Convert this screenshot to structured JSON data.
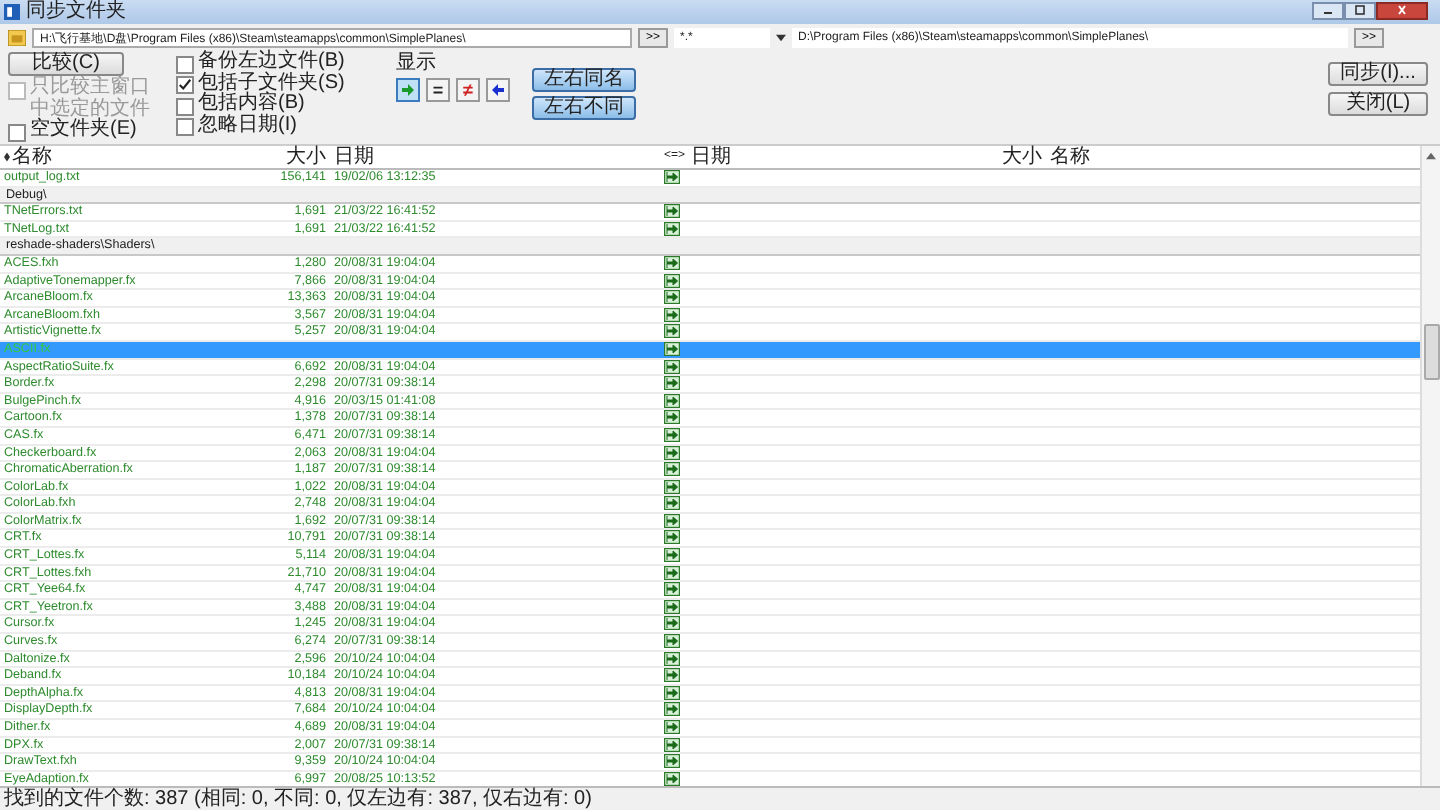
{
  "window": {
    "title": "同步文件夹"
  },
  "left_path": {
    "value": "H:\\飞行基地\\D盘\\Program Files (x86)\\Steam\\steamapps\\common\\SimplePlanes\\"
  },
  "left_browse": ">>",
  "filter": {
    "value": "*.*"
  },
  "right_path": {
    "value": "D:\\Program Files (x86)\\Steam\\steamapps\\common\\SimplePlanes\\"
  },
  "right_browse": ">>",
  "compare_button": "比较(C)",
  "left_options": [
    {
      "label": "只比较主窗口中选定的文件",
      "checked": false,
      "disabled": true
    },
    {
      "label": "空文件夹(E)",
      "checked": false,
      "disabled": false
    }
  ],
  "middle_options": [
    {
      "label": "备份左边文件(B)",
      "checked": false,
      "disabled": false
    },
    {
      "label": "包括子文件夹(S)",
      "checked": true,
      "disabled": false
    },
    {
      "label": "包括内容(B)",
      "checked": false,
      "disabled": false
    },
    {
      "label": "忽略日期(I)",
      "checked": false,
      "disabled": false
    }
  ],
  "show": {
    "label": "显示",
    "toggles": [
      {
        "kind": "right",
        "selected": true
      },
      {
        "kind": "equal",
        "symbol": "=",
        "selected": false
      },
      {
        "kind": "differ",
        "symbol": "≠",
        "selected": false
      },
      {
        "kind": "left",
        "selected": false
      }
    ]
  },
  "select_buttons": [
    "左右同名",
    "左右不同"
  ],
  "action_buttons": [
    "同步(I)...",
    "关闭(L)"
  ],
  "left_columns": [
    "名称",
    "大小",
    "日期"
  ],
  "direction_column": "<=>",
  "right_columns": [
    "日期",
    "大小",
    "名称"
  ],
  "rows": [
    {
      "kind": "file",
      "name": "output_log.txt",
      "size": "156,141",
      "date": "19/02/06 13:12:35",
      "selected": false
    },
    {
      "kind": "folder",
      "name": "Debug\\",
      "selected": false
    },
    {
      "kind": "file",
      "name": "TNetErrors.txt",
      "size": "1,691",
      "date": "21/03/22 16:41:52",
      "selected": false
    },
    {
      "kind": "file",
      "name": "TNetLog.txt",
      "size": "1,691",
      "date": "21/03/22 16:41:52",
      "selected": false
    },
    {
      "kind": "folder",
      "name": "reshade-shaders\\Shaders\\",
      "selected": false
    },
    {
      "kind": "file",
      "name": "ACES.fxh",
      "size": "1,280",
      "date": "20/08/31 19:04:04",
      "selected": false
    },
    {
      "kind": "file",
      "name": "AdaptiveTonemapper.fx",
      "size": "7,866",
      "date": "20/08/31 19:04:04",
      "selected": false
    },
    {
      "kind": "file",
      "name": "ArcaneBloom.fx",
      "size": "13,363",
      "date": "20/08/31 19:04:04",
      "selected": false
    },
    {
      "kind": "file",
      "name": "ArcaneBloom.fxh",
      "size": "3,567",
      "date": "20/08/31 19:04:04",
      "selected": false
    },
    {
      "kind": "file",
      "name": "ArtisticVignette.fx",
      "size": "5,257",
      "date": "20/08/31 19:04:04",
      "selected": false
    },
    {
      "kind": "file",
      "name": "ASCII.fx",
      "selected": true
    },
    {
      "kind": "file",
      "name": "AspectRatioSuite.fx",
      "size": "6,692",
      "date": "20/08/31 19:04:04",
      "selected": false
    },
    {
      "kind": "file",
      "name": "Border.fx",
      "size": "2,298",
      "date": "20/07/31 09:38:14",
      "selected": false
    },
    {
      "kind": "file",
      "name": "BulgePinch.fx",
      "size": "4,916",
      "date": "20/03/15 01:41:08",
      "selected": false
    },
    {
      "kind": "file",
      "name": "Cartoon.fx",
      "size": "1,378",
      "date": "20/07/31 09:38:14",
      "selected": false
    },
    {
      "kind": "file",
      "name": "CAS.fx",
      "size": "6,471",
      "date": "20/07/31 09:38:14",
      "selected": false
    },
    {
      "kind": "file",
      "name": "Checkerboard.fx",
      "size": "2,063",
      "date": "20/08/31 19:04:04",
      "selected": false
    },
    {
      "kind": "file",
      "name": "ChromaticAberration.fx",
      "size": "1,187",
      "date": "20/07/31 09:38:14",
      "selected": false
    },
    {
      "kind": "file",
      "name": "ColorLab.fx",
      "size": "1,022",
      "date": "20/08/31 19:04:04",
      "selected": false
    },
    {
      "kind": "file",
      "name": "ColorLab.fxh",
      "size": "2,748",
      "date": "20/08/31 19:04:04",
      "selected": false
    },
    {
      "kind": "file",
      "name": "ColorMatrix.fx",
      "size": "1,692",
      "date": "20/07/31 09:38:14",
      "selected": false
    },
    {
      "kind": "file",
      "name": "CRT.fx",
      "size": "10,791",
      "date": "20/07/31 09:38:14",
      "selected": false
    },
    {
      "kind": "file",
      "name": "CRT_Lottes.fx",
      "size": "5,114",
      "date": "20/08/31 19:04:04",
      "selected": false
    },
    {
      "kind": "file",
      "name": "CRT_Lottes.fxh",
      "size": "21,710",
      "date": "20/08/31 19:04:04",
      "selected": false
    },
    {
      "kind": "file",
      "name": "CRT_Yee64.fx",
      "size": "4,747",
      "date": "20/08/31 19:04:04",
      "selected": false
    },
    {
      "kind": "file",
      "name": "CRT_Yeetron.fx",
      "size": "3,488",
      "date": "20/08/31 19:04:04",
      "selected": false
    },
    {
      "kind": "file",
      "name": "Cursor.fx",
      "size": "1,245",
      "date": "20/08/31 19:04:04",
      "selected": false
    },
    {
      "kind": "file",
      "name": "Curves.fx",
      "size": "6,274",
      "date": "20/07/31 09:38:14",
      "selected": false
    },
    {
      "kind": "file",
      "name": "Daltonize.fx",
      "size": "2,596",
      "date": "20/10/24 10:04:04",
      "selected": false
    },
    {
      "kind": "file",
      "name": "Deband.fx",
      "size": "10,184",
      "date": "20/10/24 10:04:04",
      "selected": false
    },
    {
      "kind": "file",
      "name": "DepthAlpha.fx",
      "size": "4,813",
      "date": "20/08/31 19:04:04",
      "selected": false
    },
    {
      "kind": "file",
      "name": "DisplayDepth.fx",
      "size": "7,684",
      "date": "20/10/24 10:04:04",
      "selected": false
    },
    {
      "kind": "file",
      "name": "Dither.fx",
      "size": "4,689",
      "date": "20/08/31 19:04:04",
      "selected": false
    },
    {
      "kind": "file",
      "name": "DPX.fx",
      "size": "2,007",
      "date": "20/07/31 09:38:14",
      "selected": false
    },
    {
      "kind": "file",
      "name": "DrawText.fxh",
      "size": "9,359",
      "date": "20/10/24 10:04:04",
      "selected": false
    },
    {
      "kind": "file",
      "name": "EyeAdaption.fx",
      "size": "6,997",
      "date": "20/08/25 10:13:52",
      "selected": false
    }
  ],
  "status_bar": "找到的文件个数: 387 (相同: 0, 不同: 0, 仅左边有: 387, 仅右边有: 0)"
}
